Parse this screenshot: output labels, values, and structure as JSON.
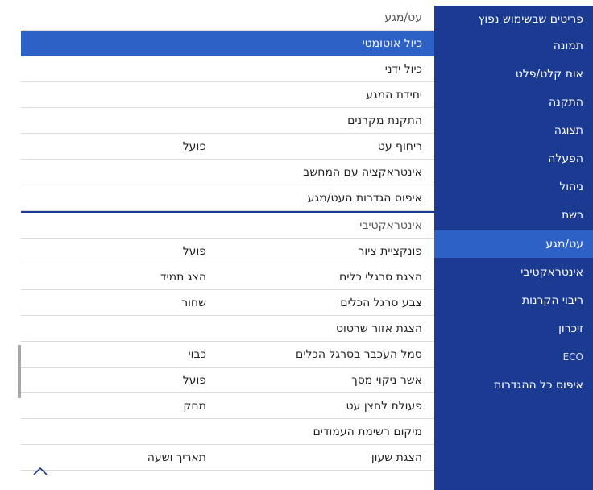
{
  "sidebar": {
    "items": [
      {
        "label": "פריטים שבשימוש נפוץ"
      },
      {
        "label": "תמונה"
      },
      {
        "label": "אות קלט/פלט"
      },
      {
        "label": "התקנה"
      },
      {
        "label": "תצוגה"
      },
      {
        "label": "הפעלה"
      },
      {
        "label": "ניהול"
      },
      {
        "label": "רשת"
      },
      {
        "label": "עט/מגע",
        "selected": true
      },
      {
        "label": "אינטראקטיבי"
      },
      {
        "label": "ריבוי הקרנות"
      },
      {
        "label": "זיכרון"
      },
      {
        "label": "ECO"
      },
      {
        "label": "איפוס כל ההגדרות"
      }
    ]
  },
  "panel": {
    "section1_title": "עט/מגע",
    "section1_rows": [
      {
        "label": "כיול אוטומטי",
        "value": "",
        "selected": true
      },
      {
        "label": "כיול ידני",
        "value": ""
      },
      {
        "label": "יחידת המגע",
        "value": ""
      },
      {
        "label": "התקנת מקרנים",
        "value": ""
      },
      {
        "label": "ריחוף עט",
        "value": "פועל"
      },
      {
        "label": "אינטראקציה עם המחשב",
        "value": ""
      },
      {
        "label": "איפוס הגדרות העט/מגע",
        "value": ""
      }
    ],
    "section2_title": "אינטראקטיבי",
    "section2_rows": [
      {
        "label": "פונקציית ציור",
        "value": "פועל"
      },
      {
        "label": "הצגת סרגלי כלים",
        "value": "הצג תמיד"
      },
      {
        "label": "צבע סרגל הכלים",
        "value": "שחור"
      },
      {
        "label": "הצגת אזור שרטוט",
        "value": ""
      },
      {
        "label": "סמל העכבר בסרגל הכלים",
        "value": "כבוי"
      },
      {
        "label": "אשר ניקוי מסך",
        "value": "פועל"
      },
      {
        "label": "פעולת לחצן עט",
        "value": "מחק"
      },
      {
        "label": "מיקום רשימת העמודים",
        "value": ""
      },
      {
        "label": "הצגת שעון",
        "value": "תאריך ושעה"
      }
    ]
  },
  "icons": {
    "scroll_up": "chevron-up-icon"
  },
  "colors": {
    "nav_bg": "#1a3b91",
    "selected_bg": "#2d61c6"
  }
}
